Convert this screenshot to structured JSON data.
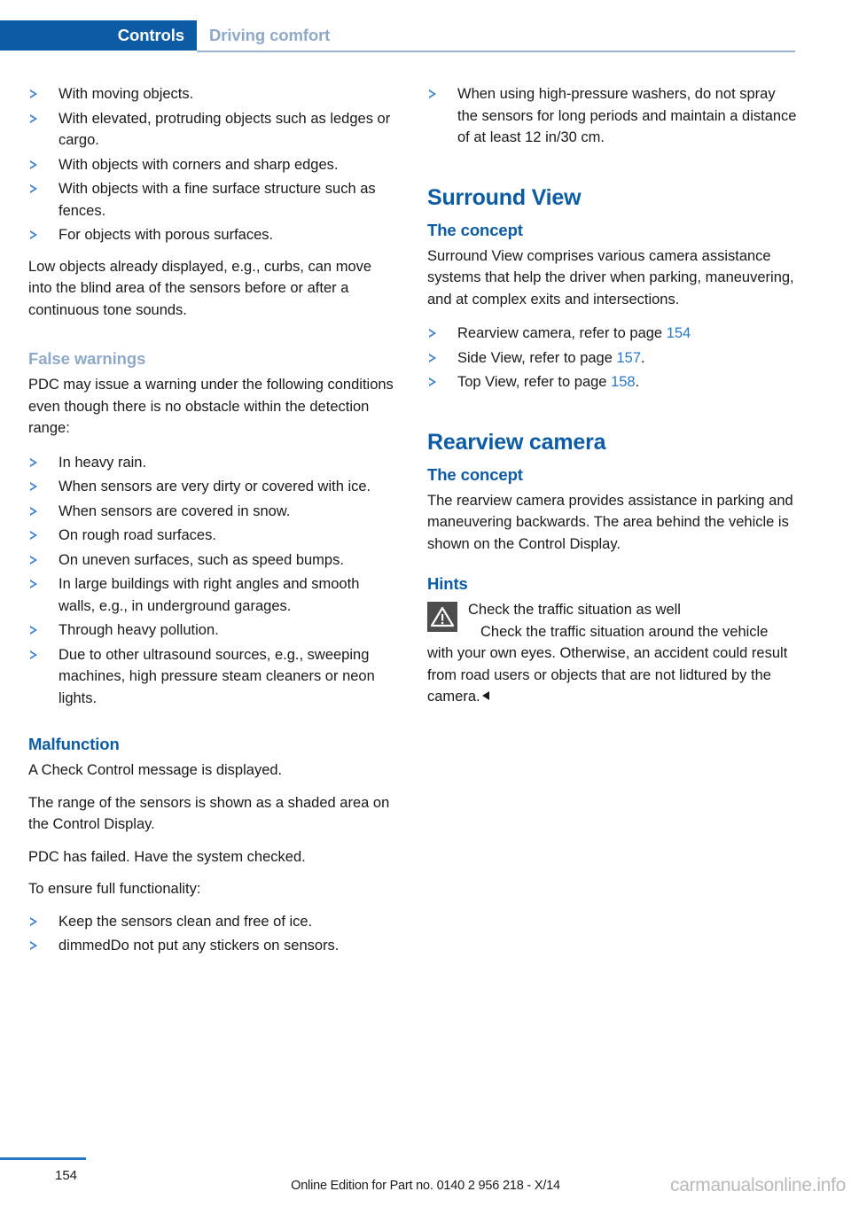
{
  "header": {
    "active_tab": "Controls",
    "inactive_tab": "Driving comfort",
    "accent_color": "#0b5ca5",
    "muted_color": "#8fa9c9"
  },
  "left_column": {
    "bullets_top": [
      "With moving objects.",
      "With elevated, protruding objects such as ledges or cargo.",
      "With objects with corners and sharp edges.",
      "With objects with a fine surface structure such as fences.",
      "For objects with porous surfaces."
    ],
    "para_low_objects": "Low objects already displayed, e.g., curbs, can move into the blind area of the sensors before or after a continuous tone sounds.",
    "false_warnings_heading": "False warnings",
    "para_false_warnings": "PDC may issue a warning under the following conditions even though there is no obstacle within the detection range:",
    "bullets_false_warnings": [
      "In heavy rain.",
      "When sensors are very dirty or covered with ice.",
      "When sensors are covered in snow.",
      "On rough road surfaces.",
      "On uneven surfaces, such as speed bumps.",
      "In large buildings with right angles and smooth walls, e.g., in underground garages.",
      "Through heavy pollution.",
      "Due to other ultrasound sources, e.g., sweeping machines, high pressure steam cleaners or neon lights."
    ],
    "malfunction_heading": "Malfunction",
    "para_check_control": "A Check Control message is displayed.",
    "para_range": "The range of the sensors is shown as a shaded area on the Control Display.",
    "para_pdc_failed": "PDC has failed. Have the system checked.",
    "para_ensure": "To ensure full functionality:",
    "bullets_malfunction": [
      "Keep the sensors clean and free of ice.",
      "dimmedDo not put any stickers on sensors."
    ]
  },
  "right_column": {
    "bullet_washers": "When using high-pressure washers, do not spray the sensors for long periods and maintain a distance of at least 12 in/30 cm.",
    "surround_view_heading": "Surround View",
    "surround_concept_heading": "The concept",
    "para_surround_concept": "Surround View comprises various camera assistance systems that help the driver when parking, maneuvering, and at complex exits and intersections.",
    "surround_links": [
      {
        "text": "Rearview camera, refer to page ",
        "page": "154",
        "suffix": ""
      },
      {
        "text": "Side View, refer to page ",
        "page": "157",
        "suffix": "."
      },
      {
        "text": "Top View, refer to page ",
        "page": "158",
        "suffix": "."
      }
    ],
    "rearview_heading": "Rearview camera",
    "rearview_concept_heading": "The concept",
    "para_rearview_concept": "The rearview camera provides assistance in parking and maneuvering backwards. The area behind the vehicle is shown on the Control Display.",
    "hints_heading": "Hints",
    "warning_icon_name": "warning-triangle-icon",
    "warning_lead": "Check the traffic situation as well",
    "warning_body": "Check the traffic situation around the vehicle with your own eyes. Otherwise, an accident could result from road users or objects that are not lidtured by the camera."
  },
  "footer": {
    "page_number": "154",
    "edition_text": "Online Edition for Part no. 0140 2 956 218 - X/14",
    "watermark": "carmanualsonline.info"
  }
}
